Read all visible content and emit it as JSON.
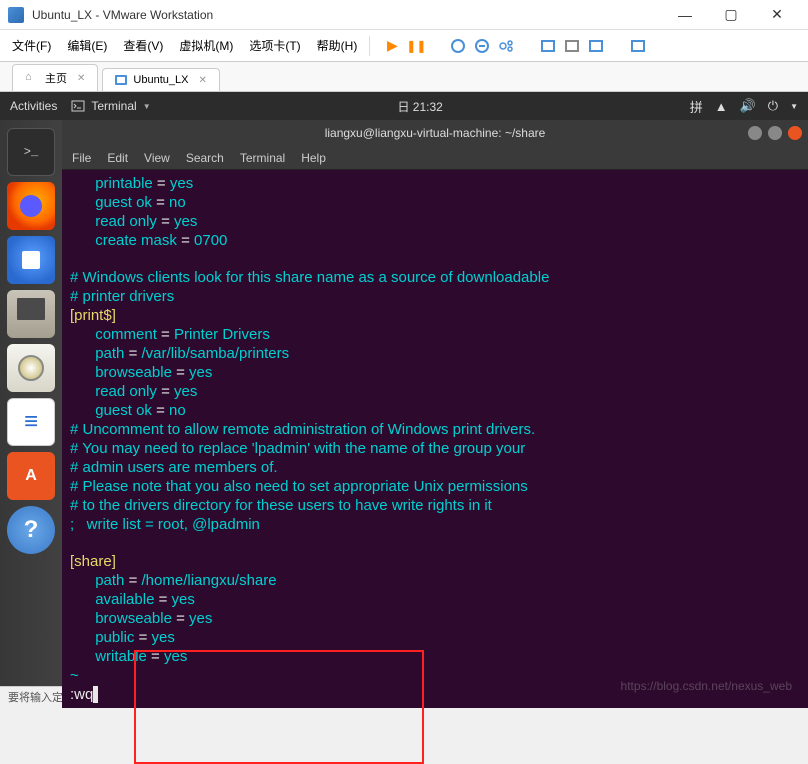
{
  "window": {
    "title": "Ubuntu_LX - VMware Workstation",
    "minimize": "—",
    "maximize": "▢",
    "close": "✕"
  },
  "vmware_menu": {
    "file": "文件(F)",
    "edit": "编辑(E)",
    "view": "查看(V)",
    "vm": "虚拟机(M)",
    "tabs": "选项卡(T)",
    "help": "帮助(H)"
  },
  "tabs": {
    "home": "主页",
    "vm_tab": "Ubuntu_LX"
  },
  "ubuntu_topbar": {
    "activities": "Activities",
    "terminal": "Terminal",
    "clock": "日 21:32"
  },
  "terminal_window": {
    "title": "liangxu@liangxu-virtual-machine: ~/share",
    "menu": {
      "file": "File",
      "edit": "Edit",
      "view": "View",
      "search": "Search",
      "terminal": "Terminal",
      "help": "Help"
    }
  },
  "config_content": {
    "top_lines": [
      {
        "indent": "   ",
        "key": "printable",
        "eq": " = ",
        "val": "yes"
      },
      {
        "indent": "   ",
        "key": "guest ok",
        "eq": " = ",
        "val": "no"
      },
      {
        "indent": "   ",
        "key": "read only",
        "eq": " = ",
        "val": "yes"
      },
      {
        "indent": "   ",
        "key": "create mask",
        "eq": " = ",
        "val": "0700"
      }
    ],
    "comment1_l1": "# Windows clients look for this share name as a source of downloadable",
    "comment1_l2": "# printer drivers",
    "section_print": "[print$]",
    "print_lines": [
      {
        "indent": "   ",
        "key": "comment",
        "eq": " = ",
        "val": "Printer Drivers"
      },
      {
        "indent": "   ",
        "key": "path",
        "eq": " = ",
        "val": "/var/lib/samba/printers"
      },
      {
        "indent": "   ",
        "key": "browseable",
        "eq": " = ",
        "val": "yes"
      },
      {
        "indent": "   ",
        "key": "read only",
        "eq": " = ",
        "val": "yes"
      },
      {
        "indent": "   ",
        "key": "guest ok",
        "eq": " = ",
        "val": "no"
      }
    ],
    "comment2_l1": "# Uncomment to allow remote administration of Windows print drivers.",
    "comment2_l2": "# You may need to replace 'lpadmin' with the name of the group your",
    "comment2_l3": "# admin users are members of.",
    "comment2_l4": "# Please note that you also need to set appropriate Unix permissions",
    "comment2_l5": "# to the drivers directory for these users to have write rights in it",
    "comment2_l6": ";   write list = root, @lpadmin",
    "section_share": "[share]",
    "share_lines": [
      {
        "indent": "   ",
        "key": "path",
        "eq": " = ",
        "val": "/home/liangxu/share"
      },
      {
        "indent": "   ",
        "key": "available",
        "eq": " = ",
        "val": "yes"
      },
      {
        "indent": "   ",
        "key": "browseable",
        "eq": " = ",
        "val": "yes"
      },
      {
        "indent": "   ",
        "key": "public",
        "eq": " = ",
        "val": "yes"
      },
      {
        "indent": "   ",
        "key": "writable",
        "eq": " = ",
        "val": "yes"
      }
    ],
    "tilde": "~",
    "cmd": ":wq"
  },
  "status_bar": {
    "hint": "要将输入定向到该虚拟机，请将鼠标指针移入其中或按 Ctrl+G。"
  }
}
